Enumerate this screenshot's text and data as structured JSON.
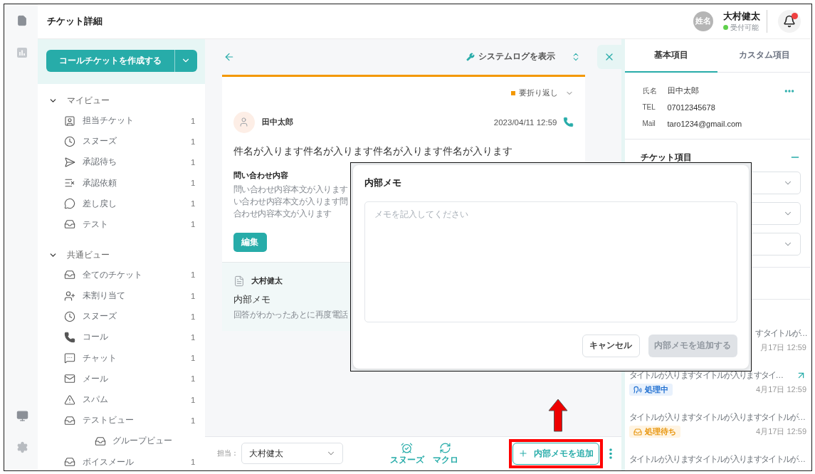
{
  "header": {
    "title": "チケット詳細",
    "user": {
      "avatar": "姓名",
      "name": "大村健太",
      "status": "受付可能"
    },
    "notification_badge": true
  },
  "sidebar": {
    "create_button": "コールチケットを作成する",
    "groups": [
      {
        "label": "マイビュー",
        "expanded": true,
        "items": [
          {
            "label": "担当チケット",
            "count": "1"
          },
          {
            "label": "スヌーズ",
            "count": "1"
          },
          {
            "label": "承認待ち",
            "count": "1"
          },
          {
            "label": "承認依頼",
            "count": "1"
          },
          {
            "label": "差し戻し",
            "count": "1"
          },
          {
            "label": "テスト",
            "count": "1"
          }
        ]
      },
      {
        "label": "共通ビュー",
        "expanded": true,
        "items": [
          {
            "label": "全てのチケット",
            "count": "1"
          },
          {
            "label": "未割り当て",
            "count": "1"
          },
          {
            "label": "スヌーズ",
            "count": "1"
          },
          {
            "label": "コール",
            "count": "1"
          },
          {
            "label": "チャット",
            "count": "1"
          },
          {
            "label": "メール",
            "count": "1"
          },
          {
            "label": "スパム",
            "count": "1"
          },
          {
            "label": "テストビュー",
            "count": "1",
            "children": [
              {
                "label": "グループビュー"
              }
            ]
          },
          {
            "label": "ボイスメール",
            "count": "1"
          }
        ]
      }
    ]
  },
  "ticket": {
    "toolbar": {
      "system_log": "システムログを表示"
    },
    "status": "要折り返し",
    "customer": "田中太郎",
    "datetime": "2023/04/11 12:59",
    "subject": "件名が入ります件名が入ります件名が入ります件名が入ります",
    "inquiry": {
      "heading": "問い合わせ内容",
      "lines": [
        "問い合わせ内容本文が入ります",
        "い合わせ内容本文が入ります問",
        "合わせ内容本文が入ります"
      ]
    },
    "edit_button": "編集",
    "memo": {
      "author": "大村健太",
      "title": "内部メモ",
      "body": "回答がわかったあとに再度電話"
    }
  },
  "footer": {
    "assignee_label": "担当：",
    "assignee": "大村健太",
    "actions": [
      {
        "label": "スヌーズ"
      },
      {
        "label": "マクロ"
      }
    ],
    "add_memo_button": "内部メモを追加"
  },
  "details": {
    "tabs": [
      {
        "label": "基本項目",
        "selected": true
      },
      {
        "label": "カスタム項目",
        "selected": false
      }
    ],
    "contact": [
      {
        "label": "氏名",
        "value": "田中太郎"
      },
      {
        "label": "TEL",
        "value": "07012345678"
      },
      {
        "label": "Mail",
        "value": "taro1234@gmail.com"
      }
    ],
    "ticket_fields": {
      "title": "チケット項目",
      "expanded": true,
      "fields": [
        {
          "kind": "select"
        },
        {
          "kind": "select"
        },
        {
          "kind": "select"
        }
      ]
    },
    "related": [
      {
        "kind": "covered",
        "title": "すタイトルが…",
        "linked": false,
        "time": "月17日 12:59"
      },
      {
        "kind": "full",
        "title": "タイトルが入りますタイトルが入りますタイ…",
        "linked": true,
        "status": {
          "kind": "in_progress",
          "label": "処理中"
        },
        "time": "4月17日 12:59"
      },
      {
        "kind": "full",
        "title": "タイトルが入りますタイトルが入りますタイトルが…",
        "linked": false,
        "status": {
          "kind": "waiting",
          "label": "処理待ち"
        },
        "time": "4月17日 12:59"
      },
      {
        "kind": "full",
        "title": "タイトルが入りますタイトルが入りますタイトルが…",
        "linked": false
      }
    ]
  },
  "dialog": {
    "title": "内部メモ",
    "placeholder": "メモを記入してください",
    "cancel_button": "キャンセル",
    "submit": {
      "label": "内部メモを追加する",
      "disabled": true
    }
  }
}
